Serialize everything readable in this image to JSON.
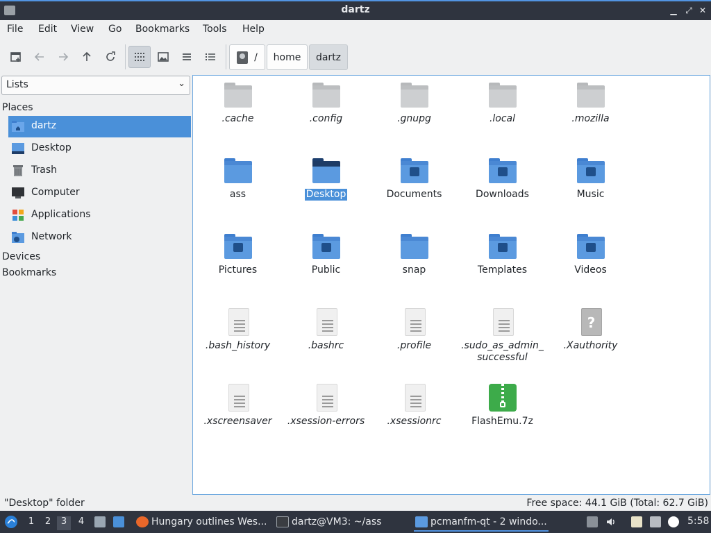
{
  "window": {
    "title": "dartz"
  },
  "menu": [
    "File",
    "Edit",
    "View",
    "Go",
    "Bookmarks",
    "Tools",
    "Help"
  ],
  "path": {
    "root": "/",
    "segments": [
      "home",
      "dartz"
    ]
  },
  "sidebar": {
    "combo_value": "Lists",
    "sections": {
      "places": "Places",
      "devices": "Devices",
      "bookmarks": "Bookmarks"
    },
    "places": [
      {
        "label": "dartz",
        "icon": "home-folder-icon"
      },
      {
        "label": "Desktop",
        "icon": "desktop-icon"
      },
      {
        "label": "Trash",
        "icon": "trash-icon"
      },
      {
        "label": "Computer",
        "icon": "computer-icon"
      },
      {
        "label": "Applications",
        "icon": "applications-icon"
      },
      {
        "label": "Network",
        "icon": "network-icon"
      }
    ]
  },
  "files": [
    {
      "name": ".cache",
      "kind": "grey"
    },
    {
      "name": ".config",
      "kind": "grey"
    },
    {
      "name": ".gnupg",
      "kind": "grey"
    },
    {
      "name": ".local",
      "kind": "grey"
    },
    {
      "name": ".mozilla",
      "kind": "grey"
    },
    {
      "name": "ass",
      "kind": "blue"
    },
    {
      "name": "Desktop",
      "kind": "dark"
    },
    {
      "name": "Documents",
      "kind": "blue"
    },
    {
      "name": "Downloads",
      "kind": "blue"
    },
    {
      "name": "Music",
      "kind": "blue"
    },
    {
      "name": "Pictures",
      "kind": "blue"
    },
    {
      "name": "Public",
      "kind": "blue"
    },
    {
      "name": "snap",
      "kind": "blue"
    },
    {
      "name": "Templates",
      "kind": "blue"
    },
    {
      "name": "Videos",
      "kind": "blue"
    },
    {
      "name": ".bash_history",
      "kind": "doc"
    },
    {
      "name": ".bashrc",
      "kind": "doc"
    },
    {
      "name": ".profile",
      "kind": "doc"
    },
    {
      "name": ".sudo_as_admin_\nsuccessful",
      "kind": "doc"
    },
    {
      "name": ".Xauthority",
      "kind": "unknown"
    },
    {
      "name": ".xscreensaver",
      "kind": "doc"
    },
    {
      "name": ".xsession-errors",
      "kind": "doc"
    },
    {
      "name": ".xsessionrc",
      "kind": "doc"
    },
    {
      "name": "FlashEmu.7z",
      "kind": "archive"
    }
  ],
  "status": {
    "left": "\"Desktop\" folder",
    "right": "Free space: 44.1 GiB (Total: 62.7 GiB)"
  },
  "taskbar": {
    "workspaces": [
      "1",
      "2",
      "3",
      "4"
    ],
    "active_workspace": "3",
    "tasks": [
      {
        "label": "Hungary outlines Wes...",
        "icon": "firefox-icon"
      },
      {
        "label": "dartz@VM3: ~/ass",
        "icon": "terminal-icon"
      },
      {
        "label": "pcmanfm-qt - 2 windo...",
        "icon": "folder-icon"
      }
    ],
    "clock": "5:58"
  },
  "colors": {
    "accent": "#4a90d9",
    "folder": "#5b9ae0",
    "titlebar": "#2f343f"
  }
}
